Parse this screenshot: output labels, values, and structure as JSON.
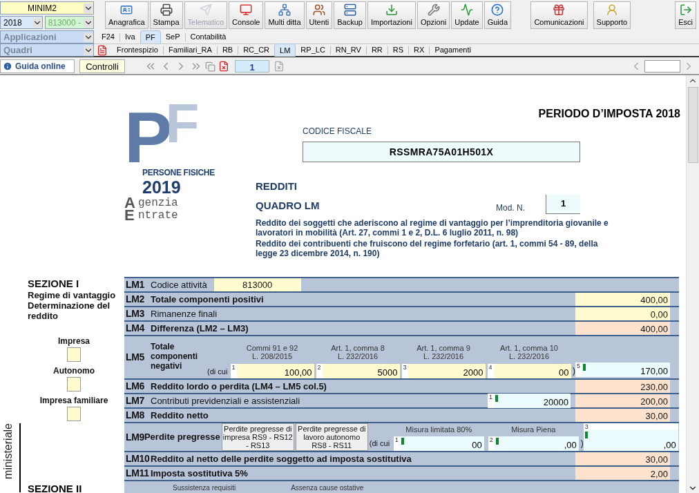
{
  "selectors": {
    "model": "MINIM2",
    "year": "2018",
    "activity": "813000 -",
    "applications": "Applicazioni",
    "panels": "Quadri"
  },
  "toolbar": [
    {
      "label": "Anagrafica",
      "disabled": false
    },
    {
      "label": "Stampa",
      "disabled": false
    },
    {
      "label": "Telematico",
      "disabled": true
    },
    {
      "label": "Console",
      "disabled": false
    },
    {
      "label": "Multi ditta",
      "disabled": false
    },
    {
      "label": "Utenti",
      "disabled": false
    },
    {
      "label": "Backup",
      "disabled": false
    },
    {
      "label": "Importazioni",
      "disabled": false
    },
    {
      "label": "Opzioni",
      "disabled": false
    },
    {
      "label": "Update",
      "disabled": false
    },
    {
      "label": "Guida",
      "disabled": false
    }
  ],
  "toolbar_right": [
    {
      "label": "Comunicazioni"
    },
    {
      "label": "Supporto"
    },
    {
      "label": "Esci"
    }
  ],
  "app_tabs": [
    {
      "label": "F24",
      "selected": false
    },
    {
      "label": "Iva",
      "selected": false
    },
    {
      "label": "PF",
      "selected": true
    },
    {
      "label": "SeP",
      "selected": false
    },
    {
      "label": "Contabilità",
      "selected": false
    }
  ],
  "panel_tabs": [
    {
      "label": "Frontespizio",
      "selected": false
    },
    {
      "label": "Familiari_RA",
      "selected": false
    },
    {
      "label": "RB",
      "selected": false
    },
    {
      "label": "RC_CR",
      "selected": false
    },
    {
      "label": "LM",
      "selected": true
    },
    {
      "label": "RP_LC",
      "selected": false
    },
    {
      "label": "RN_RV",
      "selected": false
    },
    {
      "label": "RR",
      "selected": false
    },
    {
      "label": "RS",
      "selected": false
    },
    {
      "label": "RX",
      "selected": false
    },
    {
      "label": "Pagamenti",
      "selected": false
    }
  ],
  "navigation": {
    "help": "Guida online",
    "checks": "Controlli",
    "page": "1"
  },
  "form": {
    "period": "PERIODO D’IMPOSTA 2018",
    "logo": {
      "letters": [
        "P",
        "F"
      ],
      "title": "PERSONE FISICHE",
      "year": "2019",
      "agency": [
        {
          "initial": "A",
          "rest": "genzia"
        },
        {
          "initial": "E",
          "rest": "ntrate"
        }
      ]
    },
    "tax_code_label": "CODICE FISCALE",
    "tax_code": "RSSMRA75A01H501X",
    "section_title": "REDDITI",
    "panel_title": "QUADRO LM",
    "model_label": "Mod. N.",
    "model_number": "1",
    "descriptions": [
      "Reddito dei soggetti che aderiscono al regime di vantaggio per l’imprenditoria giovanile e lavoratori in mobilità (Art. 27, commi 1 e 2, D.L. 6 luglio 2011, n. 98)",
      "Reddito dei contribuenti che fruiscono del regime forfetario (art. 1, commi 54 - 89, della legge 23 dicembre 2014, n. 190)"
    ],
    "side_label": "ministeriale",
    "section_1": {
      "title": "SEZIONE I",
      "subtitle": "Regime di vantaggio Determinazione del reddito",
      "options": [
        {
          "label": "Impresa",
          "checked": false
        },
        {
          "label": "Autonomo",
          "checked": false
        },
        {
          "label": "Impresa familiare",
          "checked": false
        }
      ],
      "rows": [
        {
          "code": "LM1",
          "kind": "code",
          "label": "Codice attività",
          "bold": false,
          "field": "813000"
        },
        {
          "code": "LM2",
          "kind": "amount",
          "label": "Totale componenti positivi",
          "bold": true,
          "value": "400,00",
          "color": "#fffbcf"
        },
        {
          "code": "LM3",
          "kind": "amount",
          "label": "Rimanenze finali",
          "bold": false,
          "value": "0,00",
          "color": "#fffbcf"
        },
        {
          "code": "LM4",
          "kind": "amount",
          "label": "Differenza (LM2 – LM3)",
          "bold": true,
          "value": "400,00",
          "color": "#fde3cd"
        },
        {
          "code": "LM5",
          "kind": "breakdown",
          "label": "Totale componenti negativi",
          "bold": true,
          "prefix": "(di cui",
          "suffix": ")",
          "parts": [
            {
              "heading": "Commi 91 e 92",
              "subheading": "L. 208/2015",
              "index": "1",
              "value": "100,00",
              "color": "#fffbcf",
              "marker": false
            },
            {
              "heading": "Art. 1, comma 8",
              "subheading": "L. 232/2016",
              "index": "2",
              "value": "5000",
              "color": "#fffbcf",
              "marker": false
            },
            {
              "heading": "Art. 1, comma 9",
              "subheading": "L. 232/2016",
              "index": "3",
              "value": "2000",
              "color": "#fffbcf",
              "marker": false
            },
            {
              "heading": "Art. 1, comma 10",
              "subheading": "L. 232/2016",
              "index": "4",
              "value": "00",
              "color": "#fffbcf",
              "marker": false
            }
          ],
          "total": {
            "index": "5",
            "value": "170,00",
            "color": "#ecfbfd",
            "marker": true
          }
        },
        {
          "code": "LM6",
          "kind": "amount",
          "label": "Reddito lordo o perdita (LM4 – LM5 col.5)",
          "bold": true,
          "value": "230,00",
          "color": "#fde3cd"
        },
        {
          "code": "LM7",
          "kind": "amount",
          "label": "Contributi previdenziali e assistenziali",
          "bold": false,
          "value": "200,00",
          "color": "#fde3cd",
          "extra": {
            "index": "1",
            "value": "20000",
            "color": "#ecfbfd",
            "marker": true
          }
        },
        {
          "code": "LM8",
          "kind": "amount",
          "label": "Reddito netto",
          "bold": true,
          "value": "30,00",
          "color": "#fde3cd"
        },
        {
          "code": "LM9",
          "kind": "losses",
          "label": "Perdite pregresse",
          "bold": true,
          "buttons": [
            "Perdite pregresse di impresa RS9 - RS12 - RS13",
            "Perdite pregresse di lavoro autonomo RS8 - RS11"
          ],
          "prefix": "(di cui",
          "suffix": ")",
          "parts": [
            {
              "heading": "Misura limitata 80%",
              "index": "1",
              "value": "00",
              "color": "#ecfbfd",
              "marker": true
            },
            {
              "heading": "Misura Piena",
              "index": "2",
              "value": ",00",
              "color": "#ecfbfd",
              "marker": true
            }
          ],
          "total": {
            "index": "3",
            "value": ",00",
            "color": "#ecfbfd",
            "marker": true
          }
        },
        {
          "code": "LM10",
          "kind": "amount",
          "label": "Reddito al netto delle perdite soggetto ad imposta sostitutiva",
          "bold": true,
          "value": "30,00",
          "color": "#fde3cd"
        },
        {
          "code": "LM11",
          "kind": "amount",
          "label": "Imposta sostitutiva 5%",
          "bold": true,
          "value": "2,00",
          "color": "#fde3cd"
        }
      ]
    },
    "section_2": {
      "title": "SEZIONE II",
      "headers": [
        "Sussistenza requisiti",
        "Assenza cause ostative"
      ]
    }
  }
}
